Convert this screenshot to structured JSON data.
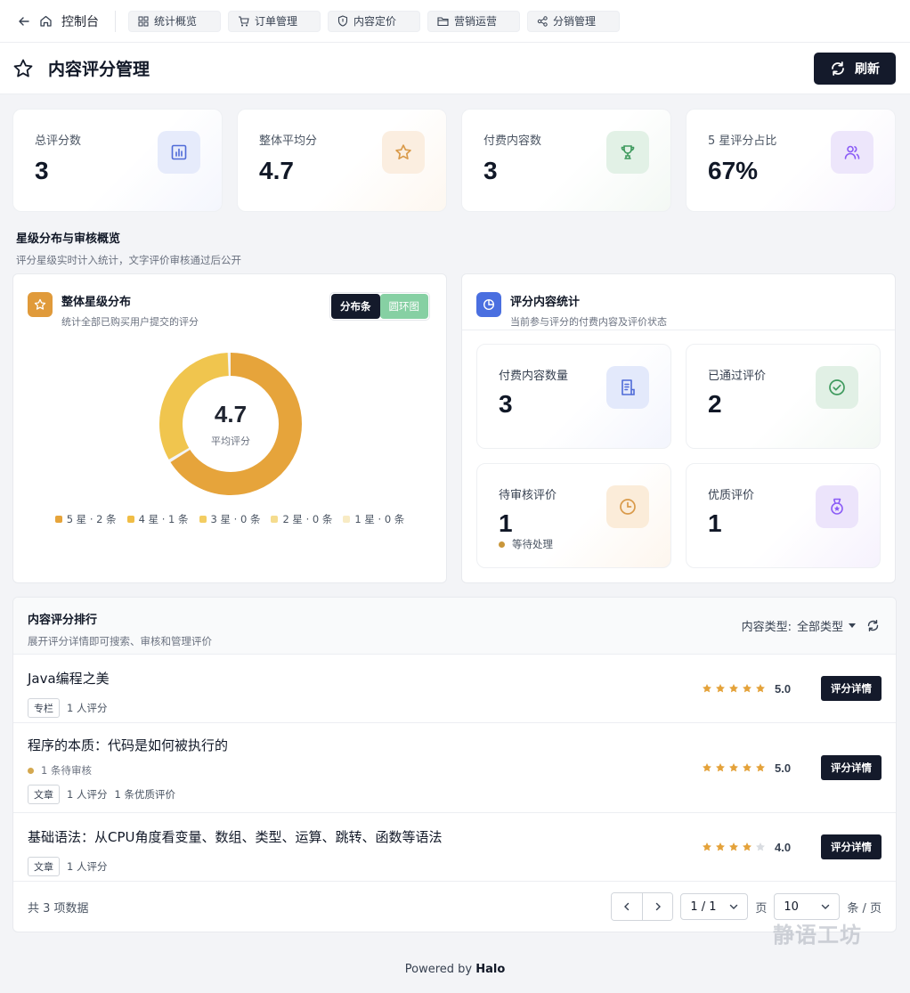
{
  "nav": {
    "back_label": "控制台",
    "tabs": [
      {
        "label": "统计概览",
        "icon": "dashboard-icon"
      },
      {
        "label": "订单管理",
        "icon": "cart-icon"
      },
      {
        "label": "内容定价",
        "icon": "shield-icon"
      },
      {
        "label": "营销运营",
        "icon": "folder-icon"
      },
      {
        "label": "分销管理",
        "icon": "share-icon"
      }
    ]
  },
  "header": {
    "title": "内容评分管理",
    "refresh_label": "刷新"
  },
  "stats": [
    {
      "label": "总评分数",
      "value": "3",
      "icon": "bar-chart-icon",
      "color": "#4f6bd8"
    },
    {
      "label": "整体平均分",
      "value": "4.7",
      "icon": "star-icon",
      "color": "#d99a4a"
    },
    {
      "label": "付费内容数",
      "value": "3",
      "icon": "trophy-icon",
      "color": "#3f9a5e"
    },
    {
      "label": "5 星评分占比",
      "value": "67%",
      "icon": "users-icon",
      "color": "#8b5cf6"
    }
  ],
  "section": {
    "title": "星级分布与审核概览",
    "subtitle": "评分星级实时计入统计，文字评价审核通过后公开"
  },
  "distribution": {
    "title": "整体星级分布",
    "subtitle": "统计全部已购买用户提交的评分",
    "seg_bar": "分布条",
    "seg_donut": "圆环图",
    "average": "4.7",
    "average_label": "平均评分",
    "legend": [
      {
        "label": "5 星 · 2 条",
        "color": "#e6a43b"
      },
      {
        "label": "4 星 · 1 条",
        "color": "#f0bd45"
      },
      {
        "label": "3 星 · 0 条",
        "color": "#f3cd62"
      },
      {
        "label": "2 星 · 0 条",
        "color": "#f5dc8e"
      },
      {
        "label": "1 星 · 0 条",
        "color": "#f8ebc4"
      }
    ]
  },
  "chart_data": {
    "type": "pie",
    "categories": [
      "5 星",
      "4 星",
      "3 星",
      "2 星",
      "1 星"
    ],
    "values": [
      2,
      1,
      0,
      0,
      0
    ],
    "colors": [
      "#e6a43b",
      "#f0c54e",
      "#f3cd62",
      "#f5dc8e",
      "#f8ebc4"
    ]
  },
  "content_stats": {
    "title": "评分内容统计",
    "subtitle": "当前参与评分的付费内容及评价状态",
    "cards": [
      {
        "label": "付费内容数量",
        "value": "3",
        "icon": "document-icon",
        "color": "#4f6bd8"
      },
      {
        "label": "已通过评价",
        "value": "2",
        "icon": "check-circle-icon",
        "color": "#3f9a5e"
      },
      {
        "label": "待审核评价",
        "value": "1",
        "icon": "clock-icon",
        "color": "#d99a4a",
        "sub": "等待处理"
      },
      {
        "label": "优质评价",
        "value": "1",
        "icon": "medal-icon",
        "color": "#8b5cf6"
      }
    ]
  },
  "ranking": {
    "title": "内容评分排行",
    "subtitle": "展开评分详情即可搜索、审核和管理评价",
    "filter_label": "内容类型:",
    "filter_value": "全部类型",
    "detail_label": "评分详情",
    "items": [
      {
        "name": "Java编程之美",
        "tag": "专栏",
        "meta": "1 人评分",
        "rating": 5,
        "score": "5.0"
      },
      {
        "name": "程序的本质：代码是如何被执行的",
        "pending": "1 条待审核",
        "tag": "文章",
        "meta": "1 人评分",
        "extra": "1 条优质评价",
        "rating": 5,
        "score": "5.0"
      },
      {
        "name": "基础语法：从CPU角度看变量、数组、类型、运算、跳转、函数等语法",
        "tag": "文章",
        "meta": "1 人评分",
        "rating": 4,
        "score": "4.0"
      }
    ]
  },
  "pager": {
    "total": "共 3 项数据",
    "page": "1 / 1",
    "page_unit": "页",
    "size": "10",
    "size_unit": "条 / 页"
  },
  "footer": {
    "prefix": "Powered by ",
    "brand": "Halo"
  },
  "watermark": "静语工坊"
}
